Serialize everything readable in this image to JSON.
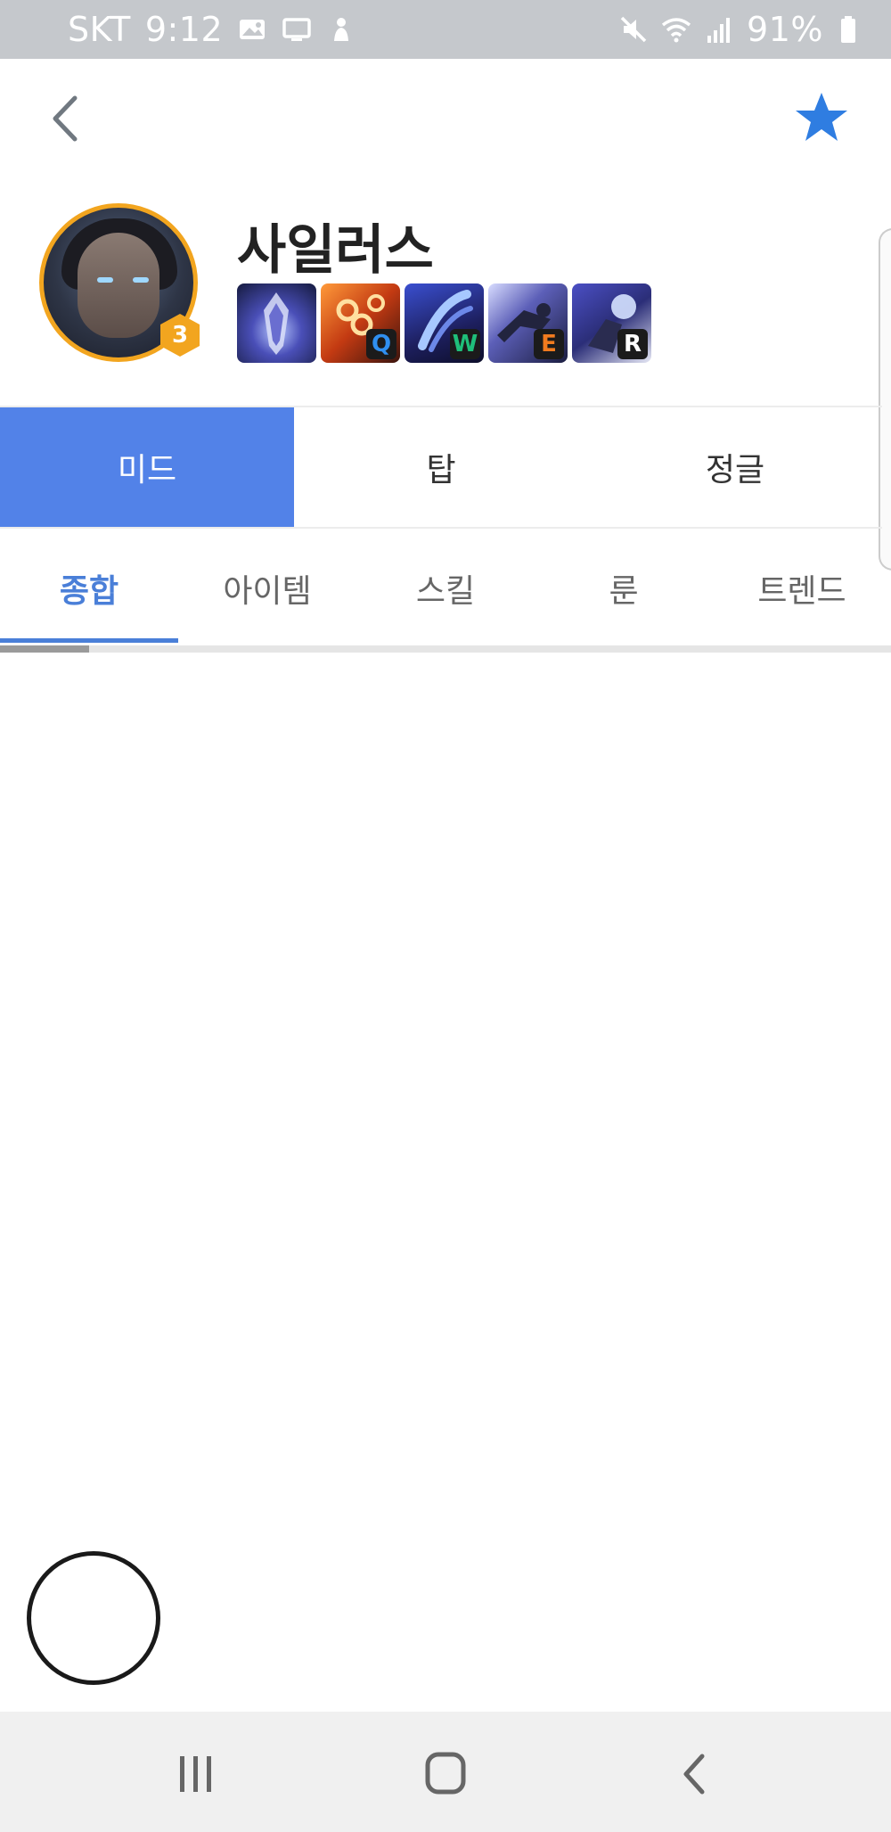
{
  "status_bar": {
    "carrier": "SKT",
    "time": "9:12",
    "battery": "91%"
  },
  "champion": {
    "name": "사일러스",
    "level": "3",
    "skills": [
      {
        "key": "",
        "icon": "passive-icon"
      },
      {
        "key": "Q",
        "icon": "skill-q-icon",
        "key_color": "#2f8ff0"
      },
      {
        "key": "W",
        "icon": "skill-w-icon",
        "key_color": "#1fbf7a"
      },
      {
        "key": "E",
        "icon": "skill-e-icon",
        "key_color": "#f07b1f"
      },
      {
        "key": "R",
        "icon": "skill-r-icon",
        "key_color": "#ffffff"
      }
    ]
  },
  "lane_tabs": [
    {
      "label": "미드",
      "active": true
    },
    {
      "label": "탑",
      "active": false
    },
    {
      "label": "정글",
      "active": false
    }
  ],
  "sub_tabs": [
    {
      "label": "종합",
      "active": true
    },
    {
      "label": "아이템",
      "active": false
    },
    {
      "label": "스킬",
      "active": false
    },
    {
      "label": "룬",
      "active": false
    },
    {
      "label": "트렌드",
      "active": false
    }
  ],
  "colors": {
    "accent": "#5282e8",
    "star": "#2f7de1",
    "badge": "#f2a51f"
  }
}
